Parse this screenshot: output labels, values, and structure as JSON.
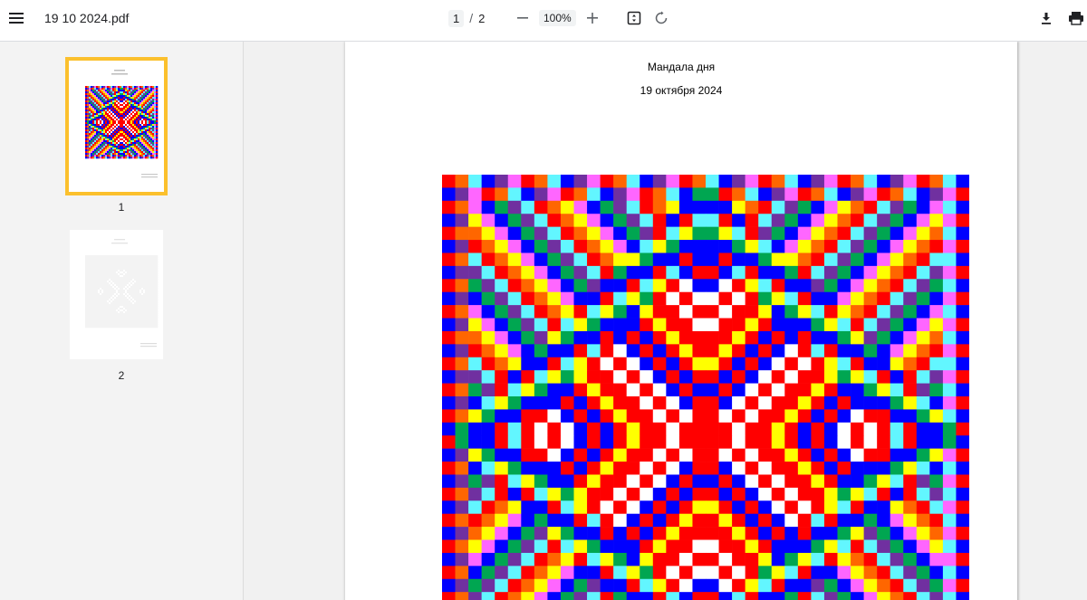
{
  "toolbar": {
    "filename": "19 10 2024.pdf",
    "current_page": "1",
    "separator": "/",
    "total_pages": "2",
    "zoom": "100%",
    "icons": {
      "menu": "menu-icon",
      "zoom_out": "minus-icon",
      "zoom_in": "plus-icon",
      "fit": "fit-page-icon",
      "rotate": "rotate-icon",
      "download": "download-icon",
      "print": "print-icon"
    }
  },
  "sidebar": {
    "thumbnails": [
      {
        "label": "1",
        "active": true
      },
      {
        "label": "2",
        "active": false
      }
    ]
  },
  "document": {
    "title": "Мандала дня",
    "date": "19 октября 2024"
  },
  "colors": {
    "accent_thumb_border": "#fbc02d",
    "palette": [
      "#ff0000",
      "#0000ff",
      "#ffffff",
      "#ffff00",
      "#00a651",
      "#62f6ff",
      "#ff66ff",
      "#7030a0",
      "#ff6600"
    ]
  }
}
